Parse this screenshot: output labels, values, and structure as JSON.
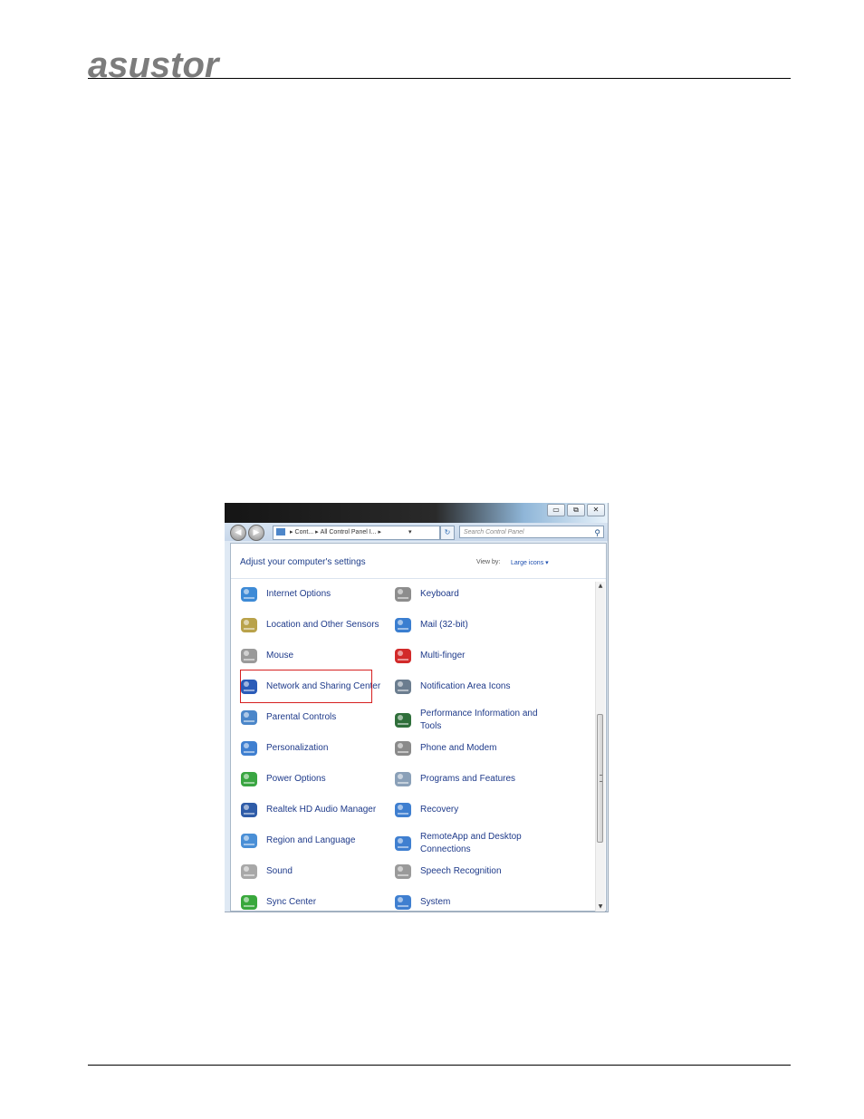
{
  "header": {
    "logo_text": "asustor"
  },
  "window": {
    "caption_buttons": [
      "▭",
      "⧉",
      "✕"
    ],
    "nav": {
      "back_glyph": "◀",
      "forward_glyph": "▶",
      "address_part1": "Cont...",
      "address_part2": "All Control Panel I...",
      "address_sep": "▸",
      "dropdown_glyph": "▾",
      "refresh_glyph": "↻",
      "search_placeholder": "Search Control Panel",
      "search_glyph": "⚲"
    },
    "heading": "Adjust your computer's settings",
    "view_by_label": "View by:",
    "view_by_value": "Large icons ▾",
    "items_left": [
      {
        "label": "Internet Options",
        "icon": "internet-options-icon",
        "color": "#3d8ad6"
      },
      {
        "label": "Location and Other Sensors",
        "icon": "location-sensors-icon",
        "color": "#b9a24a"
      },
      {
        "label": "Mouse",
        "icon": "mouse-icon",
        "color": "#9a9a9a"
      },
      {
        "label": "Network and Sharing Center",
        "icon": "network-sharing-icon",
        "color": "#2a5bb8"
      },
      {
        "label": "Parental Controls",
        "icon": "parental-controls-icon",
        "color": "#4b86c9"
      },
      {
        "label": "Personalization",
        "icon": "personalization-icon",
        "color": "#3f7fd0"
      },
      {
        "label": "Power Options",
        "icon": "power-options-icon",
        "color": "#3aa642"
      },
      {
        "label": "Realtek HD Audio Manager",
        "icon": "realtek-audio-icon",
        "color": "#2f5ca8"
      },
      {
        "label": "Region and Language",
        "icon": "region-language-icon",
        "color": "#4a8fd6"
      },
      {
        "label": "Sound",
        "icon": "sound-icon",
        "color": "#a8a8a8"
      },
      {
        "label": "Sync Center",
        "icon": "sync-center-icon",
        "color": "#39a83c"
      }
    ],
    "items_right": [
      {
        "label": "Keyboard",
        "icon": "keyboard-icon",
        "color": "#8d8d8d"
      },
      {
        "label": "Mail (32-bit)",
        "icon": "mail-icon",
        "color": "#3a7ed0"
      },
      {
        "label": "Multi-finger",
        "icon": "multi-finger-icon",
        "color": "#d22a2a"
      },
      {
        "label": "Notification Area Icons",
        "icon": "notification-area-icon",
        "color": "#6b7d8f"
      },
      {
        "label": "Performance Information and Tools",
        "icon": "performance-icon",
        "color": "#2f6f3a"
      },
      {
        "label": "Phone and Modem",
        "icon": "phone-modem-icon",
        "color": "#8a8a8a"
      },
      {
        "label": "Programs and Features",
        "icon": "programs-features-icon",
        "color": "#8aa0b8"
      },
      {
        "label": "Recovery",
        "icon": "recovery-icon",
        "color": "#3f7fd0"
      },
      {
        "label": "RemoteApp and Desktop Connections",
        "icon": "remoteapp-icon",
        "color": "#3f7fd0"
      },
      {
        "label": "Speech Recognition",
        "icon": "speech-recognition-icon",
        "color": "#9a9a9a"
      },
      {
        "label": "System",
        "icon": "system-icon",
        "color": "#3f7fd0"
      }
    ],
    "highlight_color": "#d62020",
    "scroll_up_glyph": "▲",
    "scroll_down_glyph": "▼"
  }
}
